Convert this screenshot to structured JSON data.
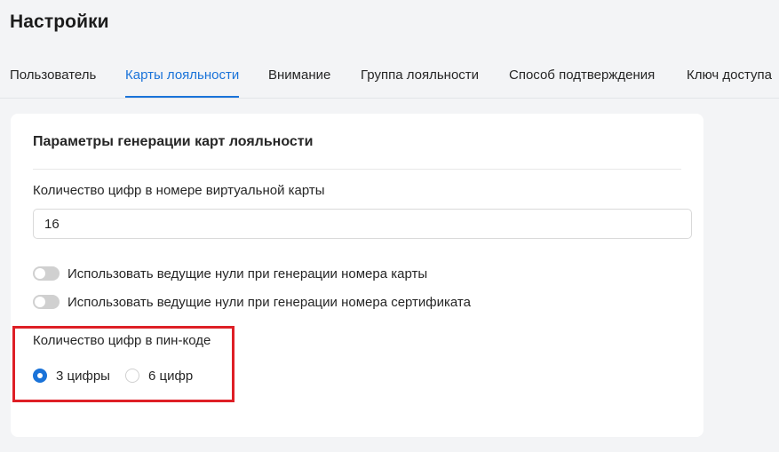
{
  "page": {
    "title": "Настройки"
  },
  "tabs": [
    {
      "label": "Пользователь",
      "active": false
    },
    {
      "label": "Карты лояльности",
      "active": true
    },
    {
      "label": "Внимание",
      "active": false
    },
    {
      "label": "Группа лояльности",
      "active": false
    },
    {
      "label": "Способ подтверждения",
      "active": false
    },
    {
      "label": "Ключ доступа",
      "active": false
    }
  ],
  "card": {
    "title": "Параметры генерации карт лояльности",
    "digits_field": {
      "label": "Количество цифр в номере виртуальной карты",
      "value": "16"
    },
    "toggles": [
      {
        "label": "Использовать ведущие нули при генерации номера карты",
        "on": false
      },
      {
        "label": "Использовать ведущие нули при генерации номера сертификата",
        "on": false
      }
    ],
    "pin": {
      "label": "Количество цифр в пин-коде",
      "options": [
        {
          "label": "3 цифры",
          "selected": true
        },
        {
          "label": "6 цифр",
          "selected": false
        }
      ]
    }
  },
  "colors": {
    "accent": "#1a73d9",
    "highlight": "#de1f26",
    "toggle_off": "#d0d0d0"
  }
}
